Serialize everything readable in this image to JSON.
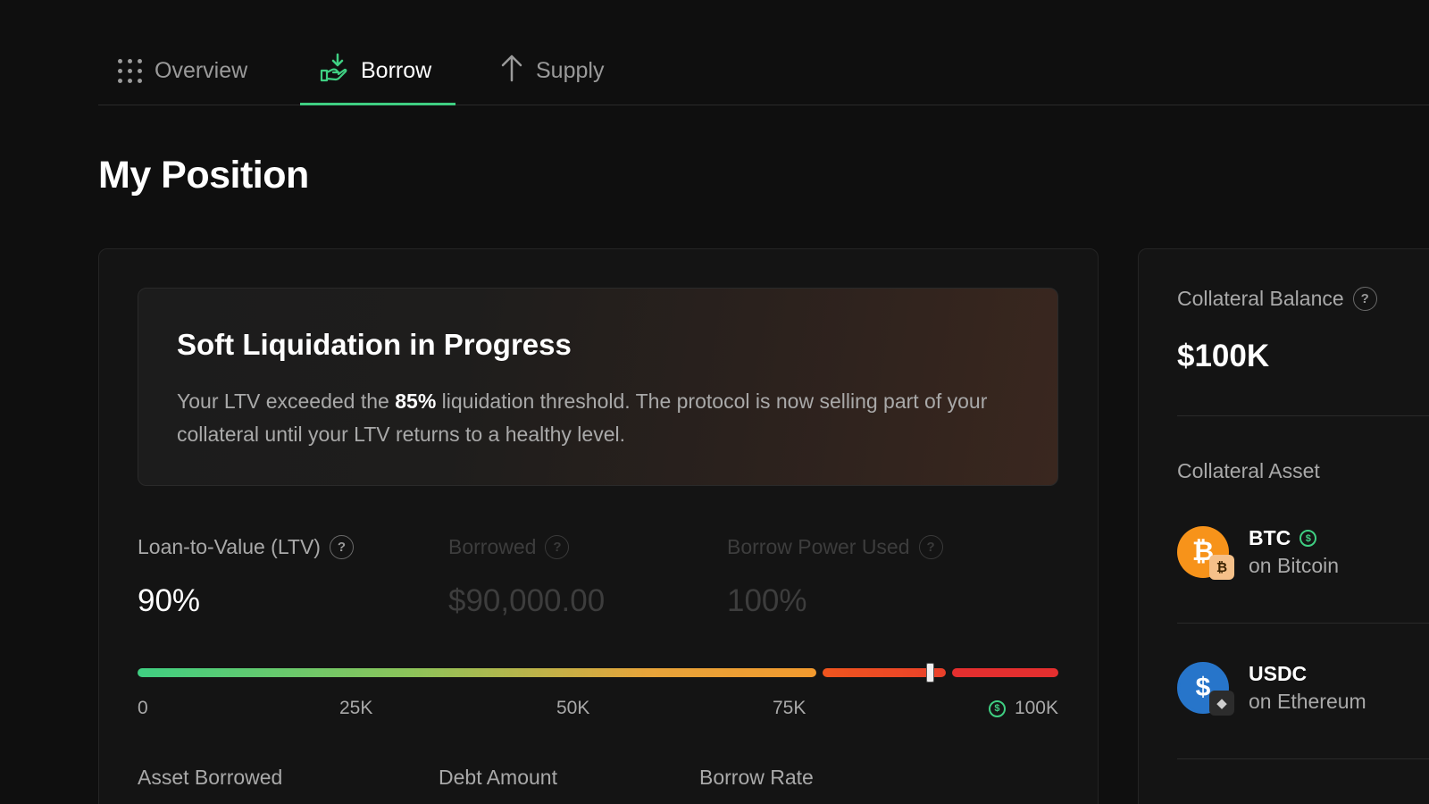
{
  "tabs": [
    {
      "label": "Overview",
      "icon": "grid-icon",
      "active": false
    },
    {
      "label": "Borrow",
      "icon": "hand-receive-icon",
      "active": true
    },
    {
      "label": "Supply",
      "icon": "arrow-up-icon",
      "active": false
    }
  ],
  "page_title": "My Position",
  "alert": {
    "title": "Soft Liquidation in Progress",
    "text_before": "Your LTV exceeded the ",
    "threshold": "85%",
    "text_after": " liquidation threshold. The protocol is now selling part of your collateral until your LTV returns to a healthy level."
  },
  "metrics": {
    "ltv": {
      "label": "Loan-to-Value (LTV)",
      "value": "90%"
    },
    "borrowed": {
      "label": "Borrowed",
      "value": "$90,000.00"
    },
    "borrow_power": {
      "label": "Borrow Power Used",
      "value": "100%"
    }
  },
  "ltv_bar": {
    "ticks": [
      "0",
      "25K",
      "50K",
      "75K",
      "100K"
    ],
    "marker_position": 0.86,
    "colors": {
      "healthy": "#3fcf82",
      "warning": "#f29a2e",
      "danger": "#e52f2f"
    }
  },
  "columns": {
    "asset": "Asset Borrowed",
    "debt": "Debt Amount",
    "rate": "Borrow Rate"
  },
  "side": {
    "collateral_balance_label": "Collateral Balance",
    "collateral_balance_value": "$100K",
    "collateral_asset_label": "Collateral Asset",
    "assets": [
      {
        "symbol": "BTC",
        "chain": "on Bitcoin",
        "icon": "btc-icon"
      },
      {
        "symbol": "USDC",
        "chain": "on Ethereum",
        "icon": "usdc-icon"
      }
    ]
  },
  "accent_color": "#3fcf82"
}
